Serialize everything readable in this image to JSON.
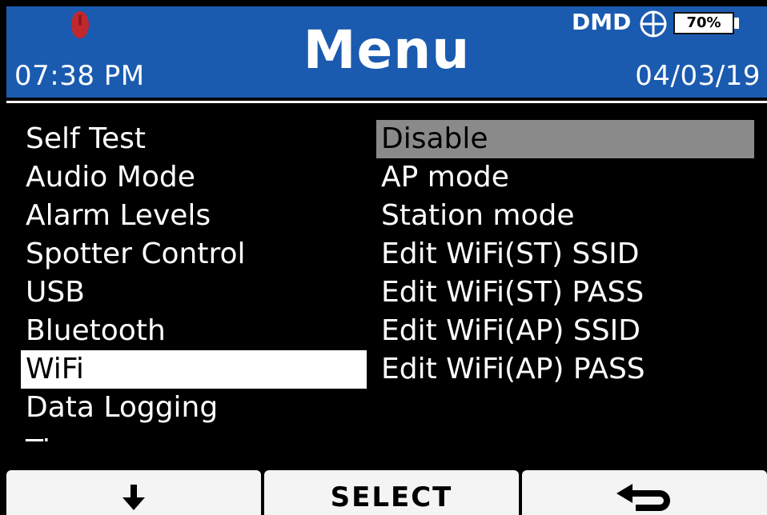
{
  "header": {
    "time": "07:38 PM",
    "title": "Menu",
    "device": "DMD",
    "battery_label": "70%",
    "battery_level": 0.7,
    "date": "04/03/19",
    "background_color": "#1a5bb0",
    "record_indicator_color": "#c0282d"
  },
  "menu_left": {
    "items": [
      {
        "label": "Self Test"
      },
      {
        "label": "Audio Mode"
      },
      {
        "label": "Alarm Levels"
      },
      {
        "label": "Spotter Control"
      },
      {
        "label": "USB"
      },
      {
        "label": "Bluetooth"
      },
      {
        "label": "WiFi",
        "selected": true
      },
      {
        "label": "Data Logging"
      }
    ],
    "partial_item": "Time"
  },
  "menu_right": {
    "items": [
      {
        "label": "Disable",
        "highlighted": true
      },
      {
        "label": "AP mode"
      },
      {
        "label": "Station mode"
      },
      {
        "label": "Edit WiFi(ST) SSID"
      },
      {
        "label": "Edit WiFi(ST) PASS"
      },
      {
        "label": "Edit WiFi(AP) SSID"
      },
      {
        "label": "Edit WiFi(AP) PASS"
      }
    ]
  },
  "softkeys": {
    "left_icon": "arrow-down-icon",
    "center_label": "SELECT",
    "right_icon": "return-arrow-icon"
  }
}
